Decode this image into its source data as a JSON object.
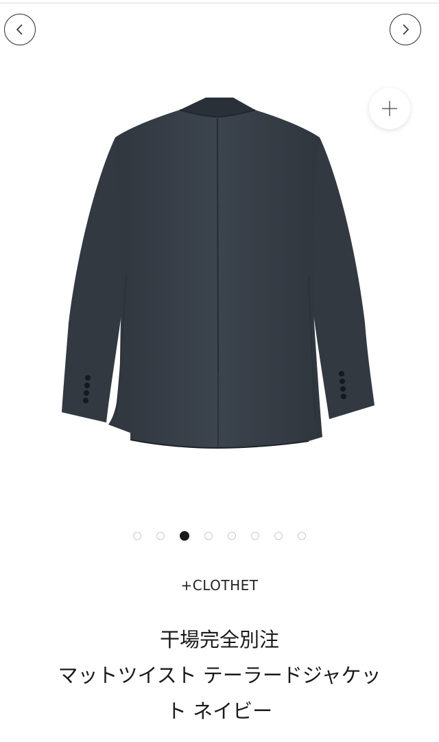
{
  "navigation": {
    "prev_icon": "chevron-left-icon",
    "next_icon": "chevron-right-icon"
  },
  "zoom": {
    "icon": "plus-icon"
  },
  "carousel": {
    "total": 8,
    "active_index": 2
  },
  "product": {
    "brand": "+CLOTHET",
    "title_lines": [
      "干場完全別注",
      "マットツイスト テーラードジャケッ",
      "ト ネイビー"
    ]
  },
  "colors": {
    "jacket": "#3a424b",
    "active_dot": "#1a1a1a"
  }
}
